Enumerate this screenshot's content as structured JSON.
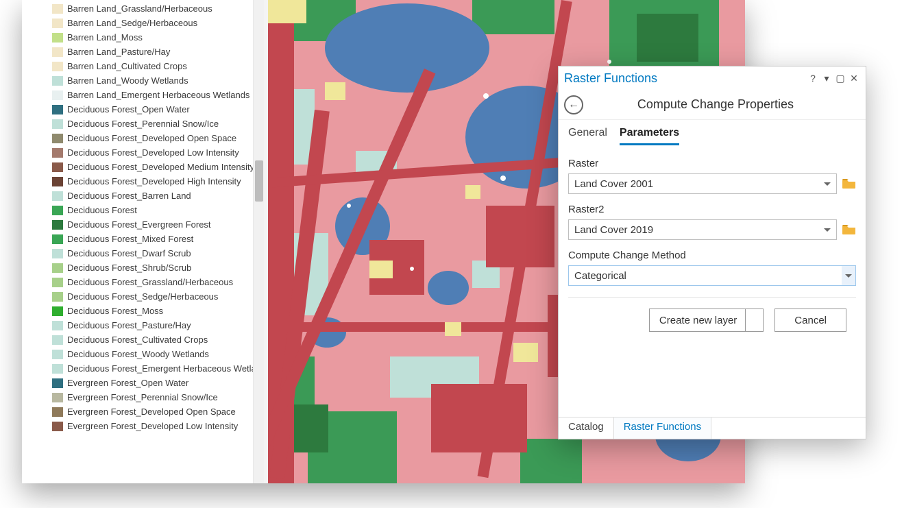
{
  "legend": {
    "items": [
      {
        "color": "#f2e6c7",
        "label": "Barren Land_Grassland/Herbaceous"
      },
      {
        "color": "#f2e6c7",
        "label": "Barren Land_Sedge/Herbaceous"
      },
      {
        "color": "#c2e089",
        "label": "Barren Land_Moss"
      },
      {
        "color": "#f2e6c7",
        "label": "Barren Land_Pasture/Hay"
      },
      {
        "color": "#f2e6c7",
        "label": "Barren Land_Cultivated Crops"
      },
      {
        "color": "#bfe0d8",
        "label": "Barren Land_Woody Wetlands"
      },
      {
        "color": "#e8f0f0",
        "label": "Barren Land_Emergent Herbaceous Wetlands"
      },
      {
        "color": "#2f6f80",
        "label": "Deciduous Forest_Open Water"
      },
      {
        "color": "#bfe0d8",
        "label": "Deciduous Forest_Perennial Snow/Ice"
      },
      {
        "color": "#8f8a6e",
        "label": "Deciduous Forest_Developed Open Space"
      },
      {
        "color": "#a47a6d",
        "label": "Deciduous Forest_Developed Low Intensity"
      },
      {
        "color": "#8a5a4a",
        "label": "Deciduous Forest_Developed Medium Intensity"
      },
      {
        "color": "#6b4335",
        "label": "Deciduous Forest_Developed High Intensity"
      },
      {
        "color": "#bfe0d8",
        "label": "Deciduous Forest_Barren Land"
      },
      {
        "color": "#3aa655",
        "label": "Deciduous Forest"
      },
      {
        "color": "#2d7a3e",
        "label": "Deciduous Forest_Evergreen Forest"
      },
      {
        "color": "#3aa655",
        "label": "Deciduous Forest_Mixed Forest"
      },
      {
        "color": "#bfe0d8",
        "label": "Deciduous Forest_Dwarf Scrub"
      },
      {
        "color": "#a7d08a",
        "label": "Deciduous Forest_Shrub/Scrub"
      },
      {
        "color": "#a7d08a",
        "label": "Deciduous Forest_Grassland/Herbaceous"
      },
      {
        "color": "#a7d08a",
        "label": "Deciduous Forest_Sedge/Herbaceous"
      },
      {
        "color": "#2fae2f",
        "label": "Deciduous Forest_Moss"
      },
      {
        "color": "#bfe0d8",
        "label": "Deciduous Forest_Pasture/Hay"
      },
      {
        "color": "#bfe0d8",
        "label": "Deciduous Forest_Cultivated Crops"
      },
      {
        "color": "#bfe0d8",
        "label": "Deciduous Forest_Woody Wetlands"
      },
      {
        "color": "#bfe0d8",
        "label": "Deciduous Forest_Emergent Herbaceous Wetlands"
      },
      {
        "color": "#2f6f80",
        "label": "Evergreen Forest_Open Water"
      },
      {
        "color": "#b8b8a0",
        "label": "Evergreen Forest_Perennial Snow/Ice"
      },
      {
        "color": "#8f7a5a",
        "label": "Evergreen Forest_Developed Open Space"
      },
      {
        "color": "#8a5a4a",
        "label": "Evergreen Forest_Developed Low Intensity"
      }
    ]
  },
  "dialog": {
    "title": "Raster Functions",
    "subtitle": "Compute Change Properties",
    "tabs": {
      "general": "General",
      "parameters": "Parameters",
      "active": "parameters"
    },
    "fields": {
      "raster": {
        "label": "Raster",
        "value": "Land Cover 2001"
      },
      "raster2": {
        "label": "Raster2",
        "value": "Land Cover 2019"
      },
      "method": {
        "label": "Compute Change Method",
        "value": "Categorical"
      }
    },
    "actions": {
      "create": "Create new layer",
      "cancel": "Cancel"
    },
    "bottom_tabs": {
      "catalog": "Catalog",
      "raster_functions": "Raster Functions"
    }
  },
  "map": {
    "palette": {
      "water": "#4f7eb5",
      "urban_pink": "#e99aa0",
      "urban_red": "#c2474f",
      "forest1": "#3b9a56",
      "forest2": "#2d7a3e",
      "wetland": "#bfe0d8",
      "crop": "#f0e79a",
      "bare": "#ffffff"
    }
  }
}
